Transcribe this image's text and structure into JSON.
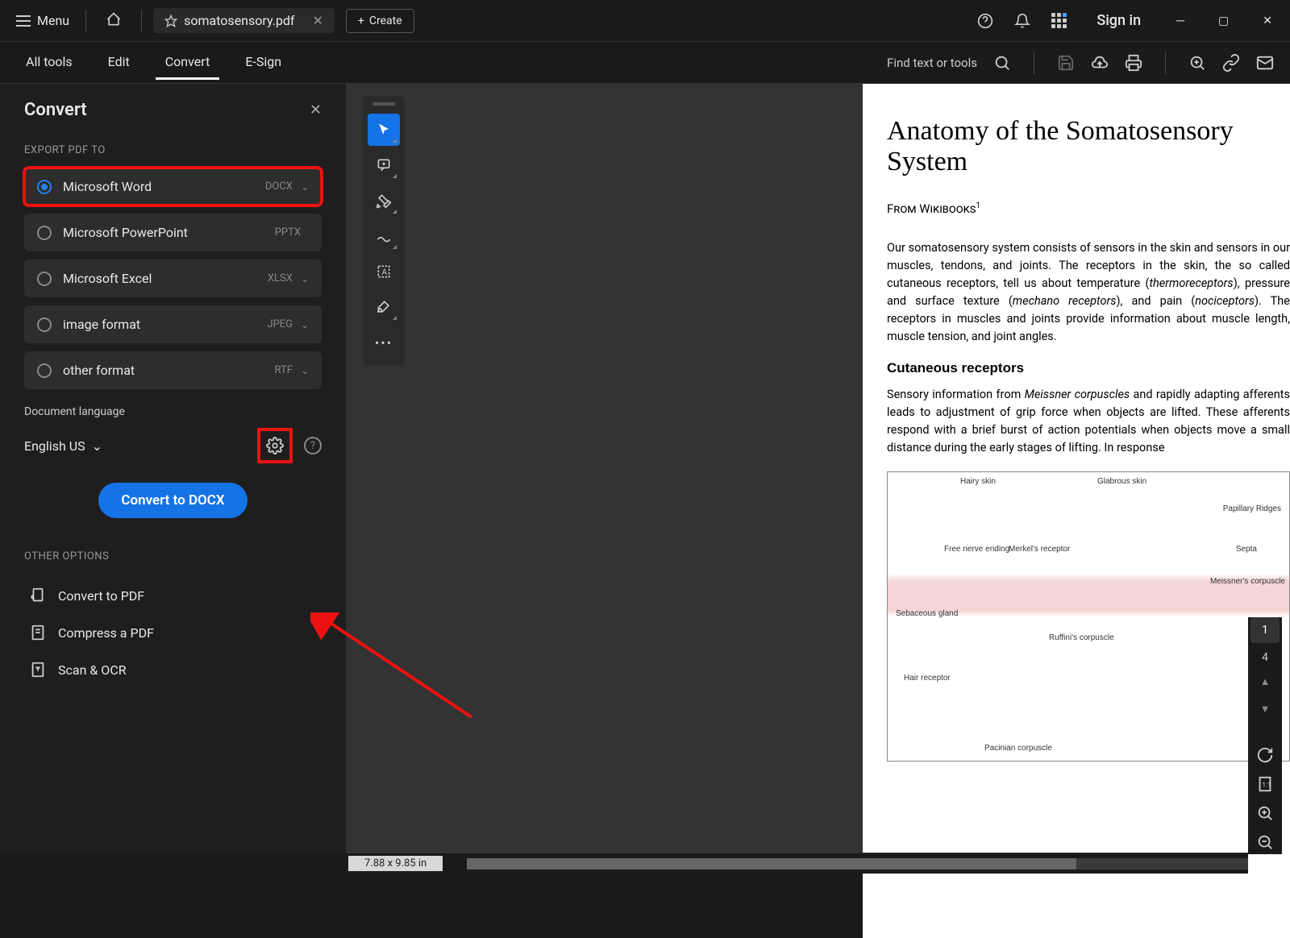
{
  "titlebar": {
    "menu_label": "Menu",
    "tab_name": "somatosensory.pdf",
    "create_label": "Create",
    "signin_label": "Sign in"
  },
  "toolbar": {
    "tabs": [
      "All tools",
      "Edit",
      "Convert",
      "E-Sign"
    ],
    "find_label": "Find text or tools"
  },
  "panel": {
    "title": "Convert",
    "export_label": "EXPORT PDF TO",
    "options": [
      {
        "name": "Microsoft Word",
        "ext": "DOCX",
        "chevron": true,
        "selected": true
      },
      {
        "name": "Microsoft PowerPoint",
        "ext": "PPTX",
        "chevron": false,
        "selected": false
      },
      {
        "name": "Microsoft Excel",
        "ext": "XLSX",
        "chevron": true,
        "selected": false
      },
      {
        "name": "image format",
        "ext": "JPEG",
        "chevron": true,
        "selected": false
      },
      {
        "name": "other format",
        "ext": "RTF",
        "chevron": true,
        "selected": false
      }
    ],
    "lang_label": "Document language",
    "lang_value": "English US",
    "convert_label": "Convert to DOCX",
    "other_label": "OTHER OPTIONS",
    "other_items": [
      "Convert to PDF",
      "Compress a PDF",
      "Scan & OCR"
    ]
  },
  "document": {
    "title": "Anatomy of the Somatosensory System",
    "subtitle_from": "From ",
    "subtitle_src": "Wikibooks",
    "para1_a": "Our somatosensory system consists of sensors in the skin and sensors in our muscles, tendons, and joints. The receptors in the skin, the so called cutaneous receptors, tell us about temperature (",
    "para1_i1": "thermoreceptors",
    "para1_b": "), pressure and surface texture (",
    "para1_i2": "mechano receptors",
    "para1_c": "), and pain (",
    "para1_i3": "nociceptors",
    "para1_d": "). The receptors in muscles and joints provide information about muscle length, muscle tension, and joint angles.",
    "h2": "Cutaneous receptors",
    "para2_a": "Sensory information from ",
    "para2_i1": "Meissner corpuscles",
    "para2_b": " and rapidly adapting afferents leads to adjustment of grip force when objects are lifted. These afferents respond with a brief burst of action potentials when objects move a small distance during the early stages of lifting. In response",
    "fig_labels": {
      "hairy": "Hairy skin",
      "glabrous": "Glabrous skin",
      "papillary": "Papillary Ridges",
      "freenerve": "Free nerve ending",
      "merkel": "Merkel's receptor",
      "septa": "Septa",
      "sebaceous": "Sebaceous gland",
      "meissner": "Meissner's corpuscle",
      "ruffini": "Ruffini's corpuscle",
      "hair": "Hair receptor",
      "pacinian": "Pacinian corpuscle"
    }
  },
  "status": {
    "dimensions": "7.88 x 9.85 in"
  },
  "pagenav": {
    "current": "1",
    "total": "4"
  }
}
